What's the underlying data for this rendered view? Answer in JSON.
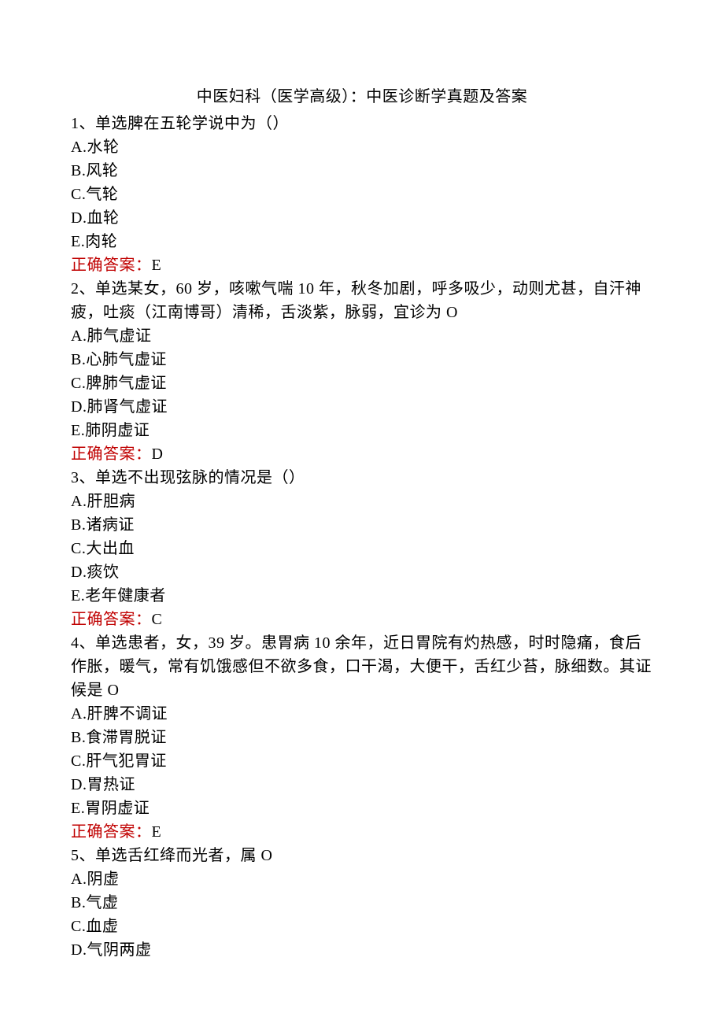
{
  "title": "中医妇科（医学高级）：中医诊断学真题及答案",
  "answer_label": "正确答案：",
  "questions": [
    {
      "number": "1",
      "type": "单选",
      "stem_parts": [
        "脾在五轮学说中为（）"
      ],
      "options": [
        {
          "label": "A",
          "text": "水轮"
        },
        {
          "label": "B",
          "text": "风轮"
        },
        {
          "label": "C",
          "text": "气轮"
        },
        {
          "label": "D",
          "text": "血轮"
        },
        {
          "label": "E",
          "text": "肉轮"
        }
      ],
      "answer": "E"
    },
    {
      "number": "2",
      "type": "单选",
      "stem_parts": [
        "某女，60 岁，咳嗽气喘 10 年，秋冬加剧，呼多吸少，动则尤甚，自汗神疲，吐痰（江南博哥）清稀，舌淡紫，脉弱，宜诊为 O"
      ],
      "options": [
        {
          "label": "A",
          "text": "肺气虚证"
        },
        {
          "label": "B",
          "text": "心肺气虚证"
        },
        {
          "label": "C",
          "text": "脾肺气虚证"
        },
        {
          "label": "D",
          "text": "肺肾气虚证"
        },
        {
          "label": "E",
          "text": "肺阴虚证"
        }
      ],
      "answer": "D"
    },
    {
      "number": "3",
      "type": "单选",
      "stem_parts": [
        "不出现弦脉的情况是（）"
      ],
      "options": [
        {
          "label": "A",
          "text": "肝胆病"
        },
        {
          "label": "B",
          "text": "诸病证"
        },
        {
          "label": "C",
          "text": "大出血"
        },
        {
          "label": "D",
          "text": "痰饮"
        },
        {
          "label": "E",
          "text": "老年健康者"
        }
      ],
      "answer": "C"
    },
    {
      "number": "4",
      "type": "单选",
      "stem_parts": [
        "患者，女，39 岁。患胃病 10 余年，近日胃院有灼热感，时时隐痛，食后作胀，暖气，常有饥饿感但不欲多食，口干渴，大便干，舌红少苔，脉细数。其证候是 O"
      ],
      "options": [
        {
          "label": "A",
          "text": "肝脾不调证"
        },
        {
          "label": "B",
          "text": "食滞胃脱证"
        },
        {
          "label": "C",
          "text": "肝气犯胃证"
        },
        {
          "label": "D",
          "text": "胃热证"
        },
        {
          "label": "E",
          "text": "胃阴虚证"
        }
      ],
      "answer": "E"
    },
    {
      "number": "5",
      "type": "单选",
      "stem_parts": [
        "舌红绛而光者，属 O"
      ],
      "options": [
        {
          "label": "A",
          "text": "阴虚"
        },
        {
          "label": "B",
          "text": "气虚"
        },
        {
          "label": "C",
          "text": "血虚"
        },
        {
          "label": "D",
          "text": "气阴两虚"
        }
      ],
      "answer": null
    }
  ]
}
